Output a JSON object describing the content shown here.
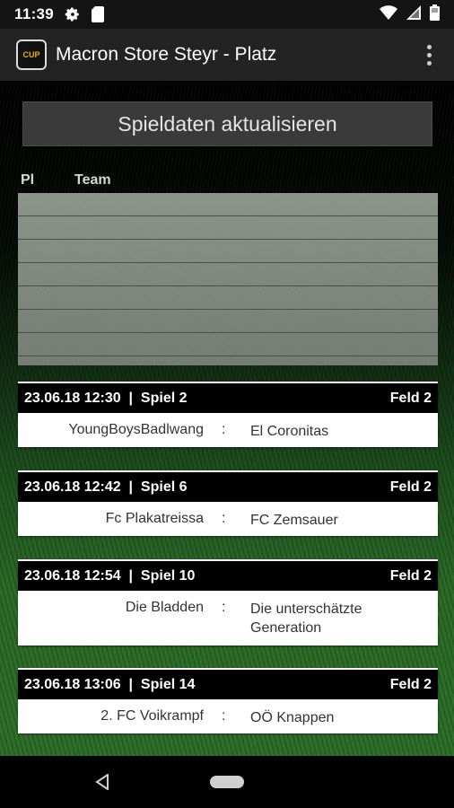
{
  "status_bar": {
    "time": "11:39",
    "icons": [
      "gear-icon",
      "sd-card-icon",
      "wifi-icon",
      "signal-icon",
      "battery-icon"
    ]
  },
  "app_bar": {
    "logo_text": "CUP",
    "title": "Macron Store Steyr - Platz",
    "menu_icon": "more-vert-icon"
  },
  "refresh_button": {
    "label": "Spieldaten aktualisieren"
  },
  "standings": {
    "headers": {
      "pl": "Pl",
      "team": "Team"
    },
    "rows": 7
  },
  "matches": [
    {
      "datetime": "23.06.18 12:30",
      "sep": "|",
      "game": "Spiel 2",
      "field": "Feld 2",
      "home": "YoungBoysBadlwang",
      "colon": ":",
      "away": "El Coronitas"
    },
    {
      "datetime": "23.06.18 12:42",
      "sep": "|",
      "game": "Spiel 6",
      "field": "Feld 2",
      "home": "Fc Plakatreissa",
      "colon": ":",
      "away": "FC Zemsauer"
    },
    {
      "datetime": "23.06.18 12:54",
      "sep": "|",
      "game": "Spiel 10",
      "field": "Feld 2",
      "home": "Die Bladden",
      "colon": ":",
      "away": "Die unterschätzte Generation"
    },
    {
      "datetime": "23.06.18 13:06",
      "sep": "|",
      "game": "Spiel 14",
      "field": "Feld 2",
      "home": "2. FC Voikrampf",
      "colon": ":",
      "away": "OÖ Knappen"
    }
  ],
  "nav_bar": {
    "back_icon": "back-triangle-icon",
    "home_icon": "home-pill-icon"
  },
  "colors": {
    "header_bg": "#000000",
    "appbar_bg": "#232323",
    "grass": "#2c7028"
  }
}
